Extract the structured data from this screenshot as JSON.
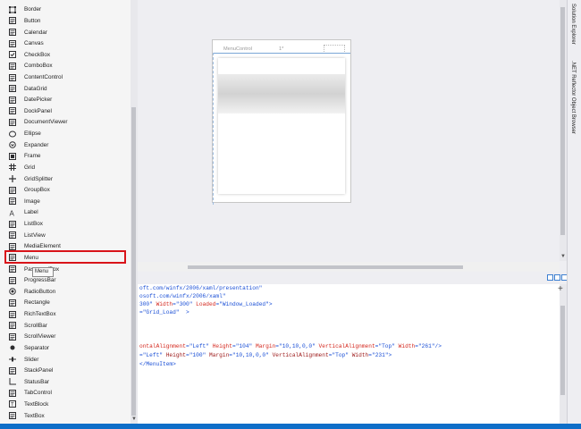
{
  "toolbox": {
    "items": [
      {
        "label": "Border",
        "icon": "border-icon"
      },
      {
        "label": "Button",
        "icon": "button-icon"
      },
      {
        "label": "Calendar",
        "icon": "calendar-icon"
      },
      {
        "label": "Canvas",
        "icon": "canvas-icon"
      },
      {
        "label": "CheckBox",
        "icon": "checkbox-icon"
      },
      {
        "label": "ComboBox",
        "icon": "combobox-icon"
      },
      {
        "label": "ContentControl",
        "icon": "contentcontrol-icon"
      },
      {
        "label": "DataGrid",
        "icon": "datagrid-icon"
      },
      {
        "label": "DatePicker",
        "icon": "datepicker-icon"
      },
      {
        "label": "DockPanel",
        "icon": "dockpanel-icon"
      },
      {
        "label": "DocumentViewer",
        "icon": "documentviewer-icon"
      },
      {
        "label": "Ellipse",
        "icon": "ellipse-icon"
      },
      {
        "label": "Expander",
        "icon": "expander-icon"
      },
      {
        "label": "Frame",
        "icon": "frame-icon"
      },
      {
        "label": "Grid",
        "icon": "grid-icon"
      },
      {
        "label": "GridSplitter",
        "icon": "gridsplitter-icon"
      },
      {
        "label": "GroupBox",
        "icon": "groupbox-icon"
      },
      {
        "label": "Image",
        "icon": "image-icon"
      },
      {
        "label": "Label",
        "icon": "label-icon"
      },
      {
        "label": "ListBox",
        "icon": "listbox-icon"
      },
      {
        "label": "ListView",
        "icon": "listview-icon"
      },
      {
        "label": "MediaElement",
        "icon": "mediaelement-icon"
      },
      {
        "label": "Menu",
        "icon": "menu-icon"
      },
      {
        "label": "PasswordBox",
        "icon": "passwordbox-icon"
      },
      {
        "label": "ProgressBar",
        "icon": "progressbar-icon"
      },
      {
        "label": "RadioButton",
        "icon": "radiobutton-icon"
      },
      {
        "label": "Rectangle",
        "icon": "rectangle-icon"
      },
      {
        "label": "RichTextBox",
        "icon": "richtextbox-icon"
      },
      {
        "label": "ScrollBar",
        "icon": "scrollbar-icon"
      },
      {
        "label": "ScrollViewer",
        "icon": "scrollviewer-icon"
      },
      {
        "label": "Separator",
        "icon": "separator-icon"
      },
      {
        "label": "Slider",
        "icon": "slider-icon"
      },
      {
        "label": "StackPanel",
        "icon": "stackpanel-icon"
      },
      {
        "label": "StatusBar",
        "icon": "statusbar-icon"
      },
      {
        "label": "TabControl",
        "icon": "tabcontrol-icon"
      },
      {
        "label": "TextBlock",
        "icon": "textblock-icon"
      },
      {
        "label": "TextBox",
        "icon": "textbox-icon"
      }
    ],
    "selected": "Menu",
    "tooltip": "Menu"
  },
  "designer": {
    "window_title": "MenuControl",
    "width_marker": "1*"
  },
  "code": {
    "lines": [
      [
        {
          "t": "oft.com/winfx/2006/xaml/presentation\"",
          "c": "c-blue"
        }
      ],
      [
        {
          "t": "osoft.com/winfx/2006/xaml\"",
          "c": "c-blue"
        }
      ],
      [
        {
          "t": "300\" ",
          "c": "c-blue"
        },
        {
          "t": "Width",
          "c": "c-red"
        },
        {
          "t": "=\"300\" ",
          "c": "c-blue"
        },
        {
          "t": "Loaded",
          "c": "c-red"
        },
        {
          "t": "=\"Window_Loaded\">",
          "c": "c-blue"
        }
      ],
      [
        {
          "t": "=\"Grid_Load\"  >",
          "c": "c-blue"
        }
      ],
      [],
      [],
      [
        {
          "t": "ontalAlignment",
          "c": "c-red"
        },
        {
          "t": "=\"Left\" ",
          "c": "c-blue"
        },
        {
          "t": "Height",
          "c": "c-red"
        },
        {
          "t": "=\"104\" ",
          "c": "c-blue"
        },
        {
          "t": "Margin",
          "c": "c-red"
        },
        {
          "t": "=\"10,10,0,0\" ",
          "c": "c-blue"
        },
        {
          "t": "VerticalAlignment",
          "c": "c-red"
        },
        {
          "t": "=\"Top\" ",
          "c": "c-blue"
        },
        {
          "t": "Width",
          "c": "c-red"
        },
        {
          "t": "=\"261\"/>",
          "c": "c-blue"
        }
      ],
      [
        {
          "t": "=\"Left\" ",
          "c": "c-blue"
        },
        {
          "t": "Height",
          "c": "c-maroon"
        },
        {
          "t": "=\"100\" ",
          "c": "c-blue"
        },
        {
          "t": "Margin",
          "c": "c-maroon"
        },
        {
          "t": "=\"10,10,0,0\" ",
          "c": "c-blue"
        },
        {
          "t": "VerticalAlignment",
          "c": "c-maroon"
        },
        {
          "t": "=\"Top\" ",
          "c": "c-blue"
        },
        {
          "t": "Width",
          "c": "c-maroon"
        },
        {
          "t": "=\"231\">",
          "c": "c-blue"
        }
      ],
      [
        {
          "t": "</MenuItem>",
          "c": "c-blue"
        }
      ]
    ]
  },
  "right_panel": {
    "tabs": [
      "Solution Explorer",
      ".NET Reflector Object Browser"
    ]
  },
  "colors": {
    "highlight": "#d9141a",
    "status_bar": "#0e6ec8",
    "xaml_value": "#1a4fd6",
    "xaml_attribute": "#d4271d"
  }
}
